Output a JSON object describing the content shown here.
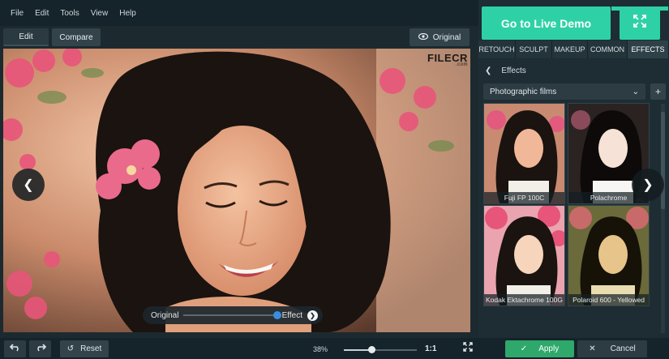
{
  "menu": [
    "File",
    "Edit",
    "Tools",
    "View",
    "Help"
  ],
  "tabs": {
    "edit": "Edit",
    "compare": "Compare",
    "original": "Original"
  },
  "watermark": {
    "main": "FILECR",
    "sub": ".com"
  },
  "compare_slider": {
    "left": "Original",
    "right": "Effect"
  },
  "bottom": {
    "reset": "Reset",
    "zoom": "38%",
    "one_to_one": "1:1",
    "apply": "Apply",
    "cancel": "Cancel",
    "zoom_fraction": 0.38
  },
  "promo": {
    "demo": "Go to Live Demo"
  },
  "tool_tabs": [
    "RETOUCH",
    "SCULPT",
    "MAKEUP",
    "COMMON",
    "EFFECTS"
  ],
  "effects": {
    "header": "Effects",
    "category": "Photographic films",
    "add": "+"
  },
  "thumbnails": [
    "Fuji FP 100C",
    "Polachrome",
    "Kodak Ektachrome 100G",
    "Polaroid 600 - Yellowed"
  ],
  "colors": {
    "accent": "#2ed1a5",
    "apply": "#2fa86b",
    "panel": "#1e2d33"
  }
}
